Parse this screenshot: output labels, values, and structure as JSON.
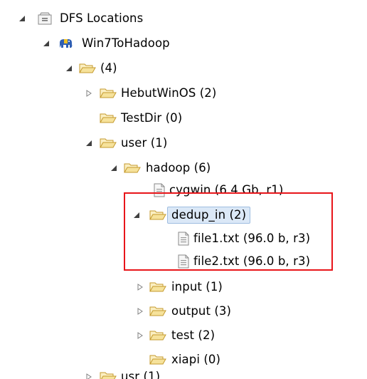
{
  "tree": {
    "nodes": [
      {
        "label": "DFS Locations",
        "state": "expanded",
        "icon": "dfs-locations-icon"
      },
      {
        "label": "Win7ToHadoop",
        "state": "expanded",
        "icon": "hadoop-elephant-icon"
      },
      {
        "label": "(4)",
        "state": "expanded",
        "icon": "folder-icon"
      },
      {
        "label": "HebutWinOS (2)",
        "state": "collapsed",
        "icon": "folder-icon"
      },
      {
        "label": "TestDir (0)",
        "state": "leaf",
        "icon": "folder-icon"
      },
      {
        "label": "user (1)",
        "state": "expanded",
        "icon": "folder-icon"
      },
      {
        "label": "hadoop (6)",
        "state": "expanded",
        "icon": "folder-icon"
      },
      {
        "label": "cygwin (6.4 Gb, r1)",
        "state": "leaf",
        "icon": "file-icon"
      },
      {
        "label": "dedup_in (2)",
        "state": "expanded",
        "icon": "folder-icon",
        "selected": true
      },
      {
        "label": "file1.txt (96.0 b, r3)",
        "state": "leaf",
        "icon": "file-icon"
      },
      {
        "label": "file2.txt (96.0 b, r3)",
        "state": "leaf",
        "icon": "file-icon"
      },
      {
        "label": "input (1)",
        "state": "collapsed",
        "icon": "folder-icon"
      },
      {
        "label": "output (3)",
        "state": "collapsed",
        "icon": "folder-icon"
      },
      {
        "label": "test (2)",
        "state": "collapsed",
        "icon": "folder-icon"
      },
      {
        "label": "xiapi (0)",
        "state": "leaf",
        "icon": "folder-icon"
      },
      {
        "label": "usr (1)",
        "state": "collapsed",
        "icon": "folder-icon"
      }
    ]
  },
  "colors": {
    "highlight_border": "#e8151a",
    "selection_fill": "#dbe8f7",
    "folder_fill": "#f6e29b",
    "folder_stroke": "#c49a2c",
    "elephant": "#2f5fb3"
  }
}
